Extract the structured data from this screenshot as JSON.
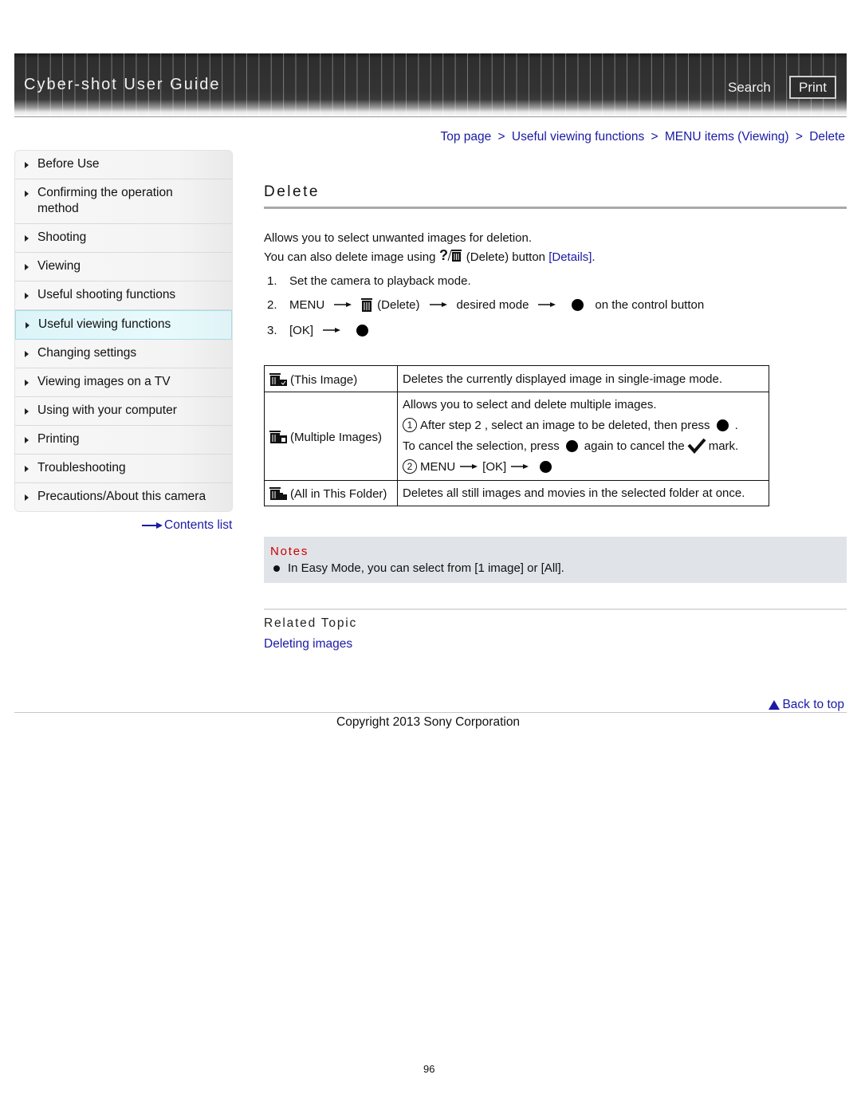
{
  "header": {
    "title": "Cyber-shot User Guide",
    "search_label": "Search",
    "print_label": "Print"
  },
  "breadcrumb": [
    {
      "label": "Top page"
    },
    {
      "label": "Useful viewing functions"
    },
    {
      "label": "MENU items (Viewing)"
    },
    {
      "label": "Delete"
    }
  ],
  "breadcrumb_separator": ">",
  "sidebar": {
    "items": [
      {
        "label": "Before Use"
      },
      {
        "label": "Confirming the operation method"
      },
      {
        "label": "Shooting"
      },
      {
        "label": "Viewing"
      },
      {
        "label": "Useful shooting functions"
      },
      {
        "label": "Useful viewing functions",
        "active": true
      },
      {
        "label": "Changing settings"
      },
      {
        "label": "Viewing images on a TV"
      },
      {
        "label": "Using with your computer"
      },
      {
        "label": "Printing"
      },
      {
        "label": "Troubleshooting"
      },
      {
        "label": "Precautions/About this camera"
      }
    ],
    "contents_list": "Contents list"
  },
  "main": {
    "title": "Delete",
    "intro_line1": "Allows you to select unwanted images for deletion.",
    "intro_line2_pre": "You can also delete image using",
    "intro_line2_mid": "(Delete) button",
    "intro_details_link": "[Details]",
    "intro_line2_post": ".",
    "steps": {
      "s1_num": "1.",
      "s1_text": "Set the camera to playback mode.",
      "s2_num": "2.",
      "s2_menu": "MENU",
      "s2_delete": "(Delete)",
      "s2_mode": "desired mode",
      "s2_end": "on the control button",
      "s3_num": "3.",
      "s3_ok": "[OK]"
    },
    "table": {
      "r1_label": "(This Image)",
      "r1_desc": "Deletes the currently displayed image in single-image mode.",
      "r2_label": "(Multiple Images)",
      "r2_line1": "Allows you to select and delete multiple images.",
      "r2_c1": "1",
      "r2_line2a": "After step 2 , select an image to be deleted, then press",
      "r2_line2b": ".",
      "r2_line3a": "To cancel the selection, press",
      "r2_line3b": "again to cancel the",
      "r2_line3c": "mark.",
      "r2_c2": "2",
      "r2_menu": "MENU",
      "r2_ok": "[OK]",
      "r3_label": "(All in This Folder)",
      "r3_desc": "Deletes all still images and movies in the selected folder at once."
    },
    "notes": {
      "heading": "Notes",
      "items": [
        "In Easy Mode, you can select from [1 image] or [All]."
      ]
    },
    "related": {
      "heading": "Related Topic",
      "link": "Deleting images"
    }
  },
  "footer": {
    "back_to_top": "Back to top",
    "copyright": "Copyright 2013 Sony Corporation",
    "page_number": "96"
  },
  "colors": {
    "link": "#1a1aa6",
    "notes_heading": "#cc0000",
    "notes_bg": "#e0e3e8"
  }
}
